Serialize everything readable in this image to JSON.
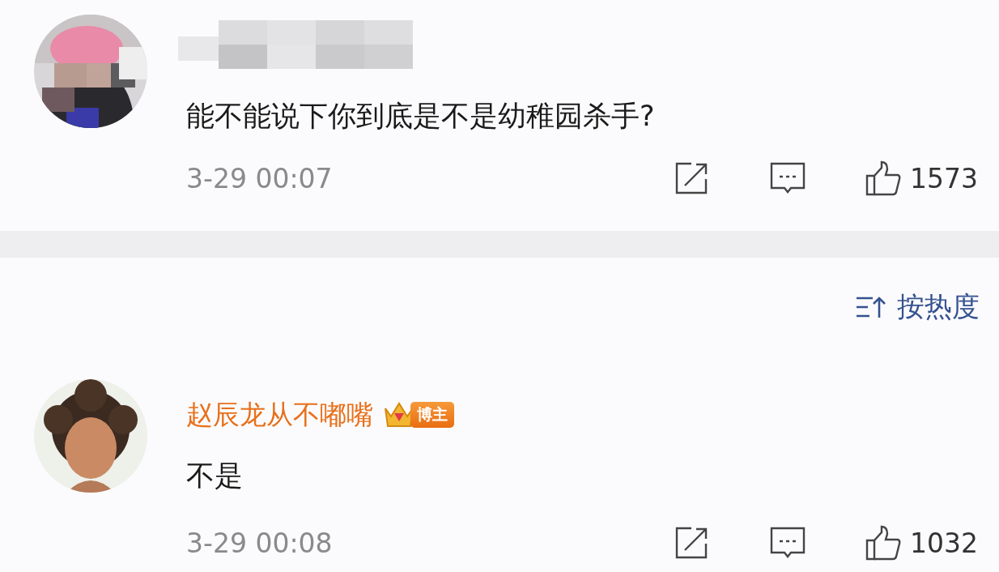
{
  "comments": [
    {
      "name_hidden": true,
      "text": "能不能说下你到底是不是幼稚园杀手?",
      "time": "3-29 00:07",
      "likes": "1573"
    },
    {
      "name": "赵辰龙从不嘟嘴",
      "badge": "博主",
      "text": "不是",
      "time": "3-29 00:08",
      "likes": "1032"
    }
  ],
  "sort": {
    "label": "按热度"
  }
}
